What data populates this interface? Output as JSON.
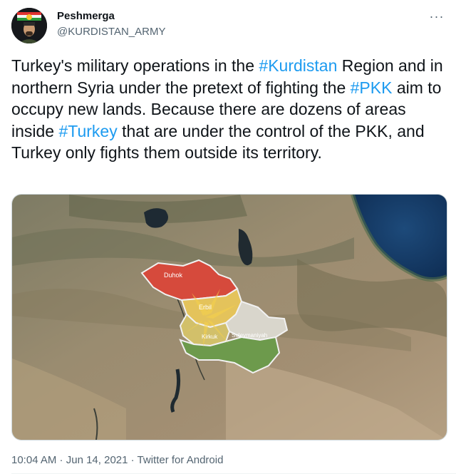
{
  "author": {
    "name": "Peshmerga",
    "handle": "@KURDISTAN_ARMY"
  },
  "menu": {
    "icon": "more-horizontal-icon",
    "glyph": "···"
  },
  "tweet": {
    "segments": [
      {
        "text": "Turkey's military operations in the ",
        "type": "text"
      },
      {
        "text": "#Kurdistan",
        "type": "hashtag"
      },
      {
        "text": " Region and in northern Syria under the pretext of fighting the ",
        "type": "text"
      },
      {
        "text": "#PKK",
        "type": "hashtag"
      },
      {
        "text": " aim to occupy new lands.  Because there are dozens of areas inside ",
        "type": "text"
      },
      {
        "text": "#Turkey",
        "type": "hashtag"
      },
      {
        "text": " that are under the control of the PKK, and Turkey only fights them outside its territory.",
        "type": "text"
      }
    ]
  },
  "media": {
    "map_labels": {
      "duhok": "Duhok",
      "erbil": "Erbil",
      "kirkuk": "Kirkuk",
      "suleymaniyah": "Suleymaniyah"
    }
  },
  "meta": {
    "time": "10:04 AM",
    "sep1": " · ",
    "date": "Jun 14, 2021",
    "sep2": " · ",
    "source": "Twitter for Android"
  },
  "colors": {
    "hashtag": "#1d9bf0",
    "secondary_text": "#536471",
    "primary_text": "#0f1419"
  }
}
